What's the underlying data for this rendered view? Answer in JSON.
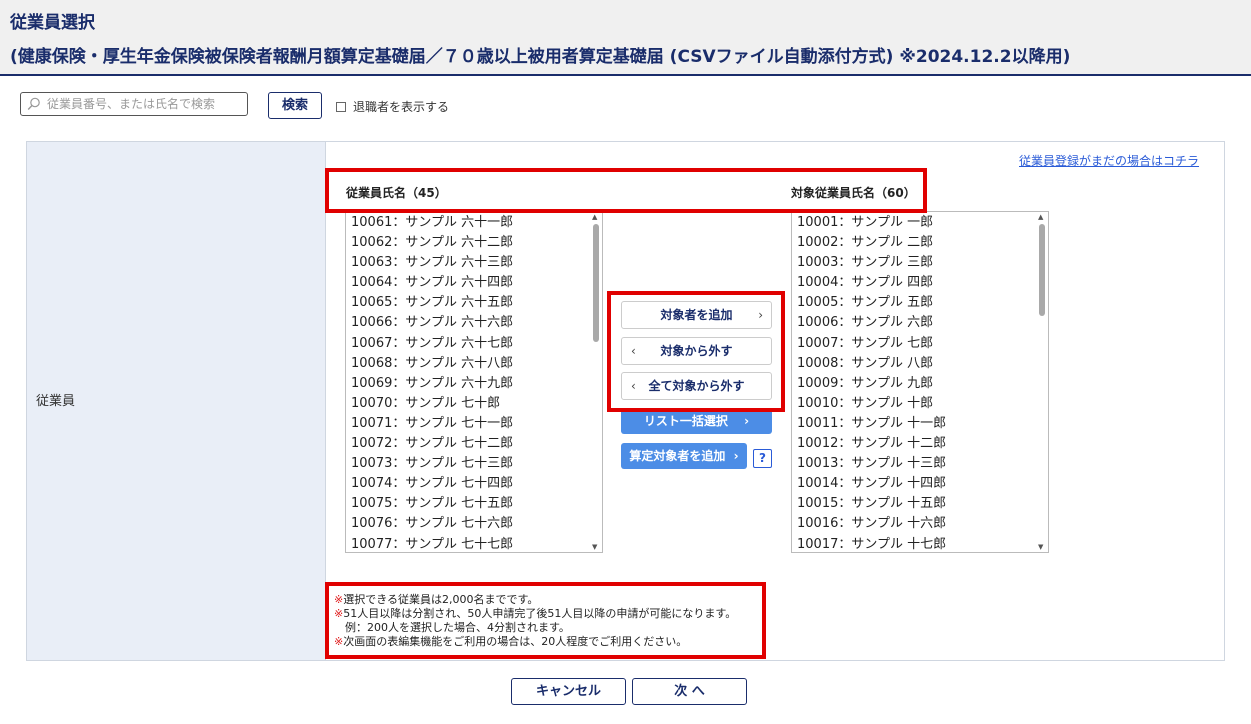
{
  "header": {
    "title": "従業員選択",
    "subtitle": "(健康保険・厚生年金保険被保険者報酬月額算定基礎届／７０歳以上被用者算定基礎届 (CSVファイル自動添付方式) ※2024.12.2以降用)"
  },
  "search": {
    "placeholder": "従業員番号、または氏名で検索",
    "button_label": "検索",
    "show_retired_label": "退職者を表示する",
    "show_retired_checked": false
  },
  "panel": {
    "row_label": "従業員",
    "register_link": "従業員登録がまだの場合はコチラ",
    "left_header": "従業員氏名（45）",
    "right_header": "対象従業員氏名（60）",
    "left_list": [
      "10061：サンプル 六十一郎",
      "10062：サンプル 六十二郎",
      "10063：サンプル 六十三郎",
      "10064：サンプル 六十四郎",
      "10065：サンプル 六十五郎",
      "10066：サンプル 六十六郎",
      "10067：サンプル 六十七郎",
      "10068：サンプル 六十八郎",
      "10069：サンプル 六十九郎",
      "10070：サンプル 七十郎",
      "10071：サンプル 七十一郎",
      "10072：サンプル 七十二郎",
      "10073：サンプル 七十三郎",
      "10074：サンプル 七十四郎",
      "10075：サンプル 七十五郎",
      "10076：サンプル 七十六郎",
      "10077：サンプル 七十七郎"
    ],
    "right_list": [
      "10001：サンプル 一郎",
      "10002：サンプル 二郎",
      "10003：サンプル 三郎",
      "10004：サンプル 四郎",
      "10005：サンプル 五郎",
      "10006：サンプル 六郎",
      "10007：サンプル 七郎",
      "10008：サンプル 八郎",
      "10009：サンプル 九郎",
      "10010：サンプル 十郎",
      "10011：サンプル 十一郎",
      "10012：サンプル 十二郎",
      "10013：サンプル 十三郎",
      "10014：サンプル 十四郎",
      "10015：サンプル 十五郎",
      "10016：サンプル 十六郎",
      "10017：サンプル 十七郎"
    ],
    "buttons": {
      "add_target": "対象者を追加",
      "remove_target": "対象から外す",
      "remove_all": "全て対象から外す",
      "bulk_select": "リスト一括選択",
      "add_calc_target": "算定対象者を追加"
    },
    "notes": {
      "mark": "※",
      "line1": "選択できる従業員は2,000名までです。",
      "line2": "51人目以降は分割され、50人申請完了後51人目以降の申請が可能になります。",
      "line3": "例：200人を選択した場合、4分割されます。",
      "line4": "次画面の表編集機能をご利用の場合は、20人程度でご利用ください。"
    }
  },
  "footer": {
    "cancel_label": "キャンセル",
    "next_label": "次 へ"
  },
  "colors": {
    "brand_navy": "#1a2d6b",
    "accent_blue": "#4c8de6",
    "highlight_red": "#e00000",
    "label_bg": "#e9eef7"
  }
}
